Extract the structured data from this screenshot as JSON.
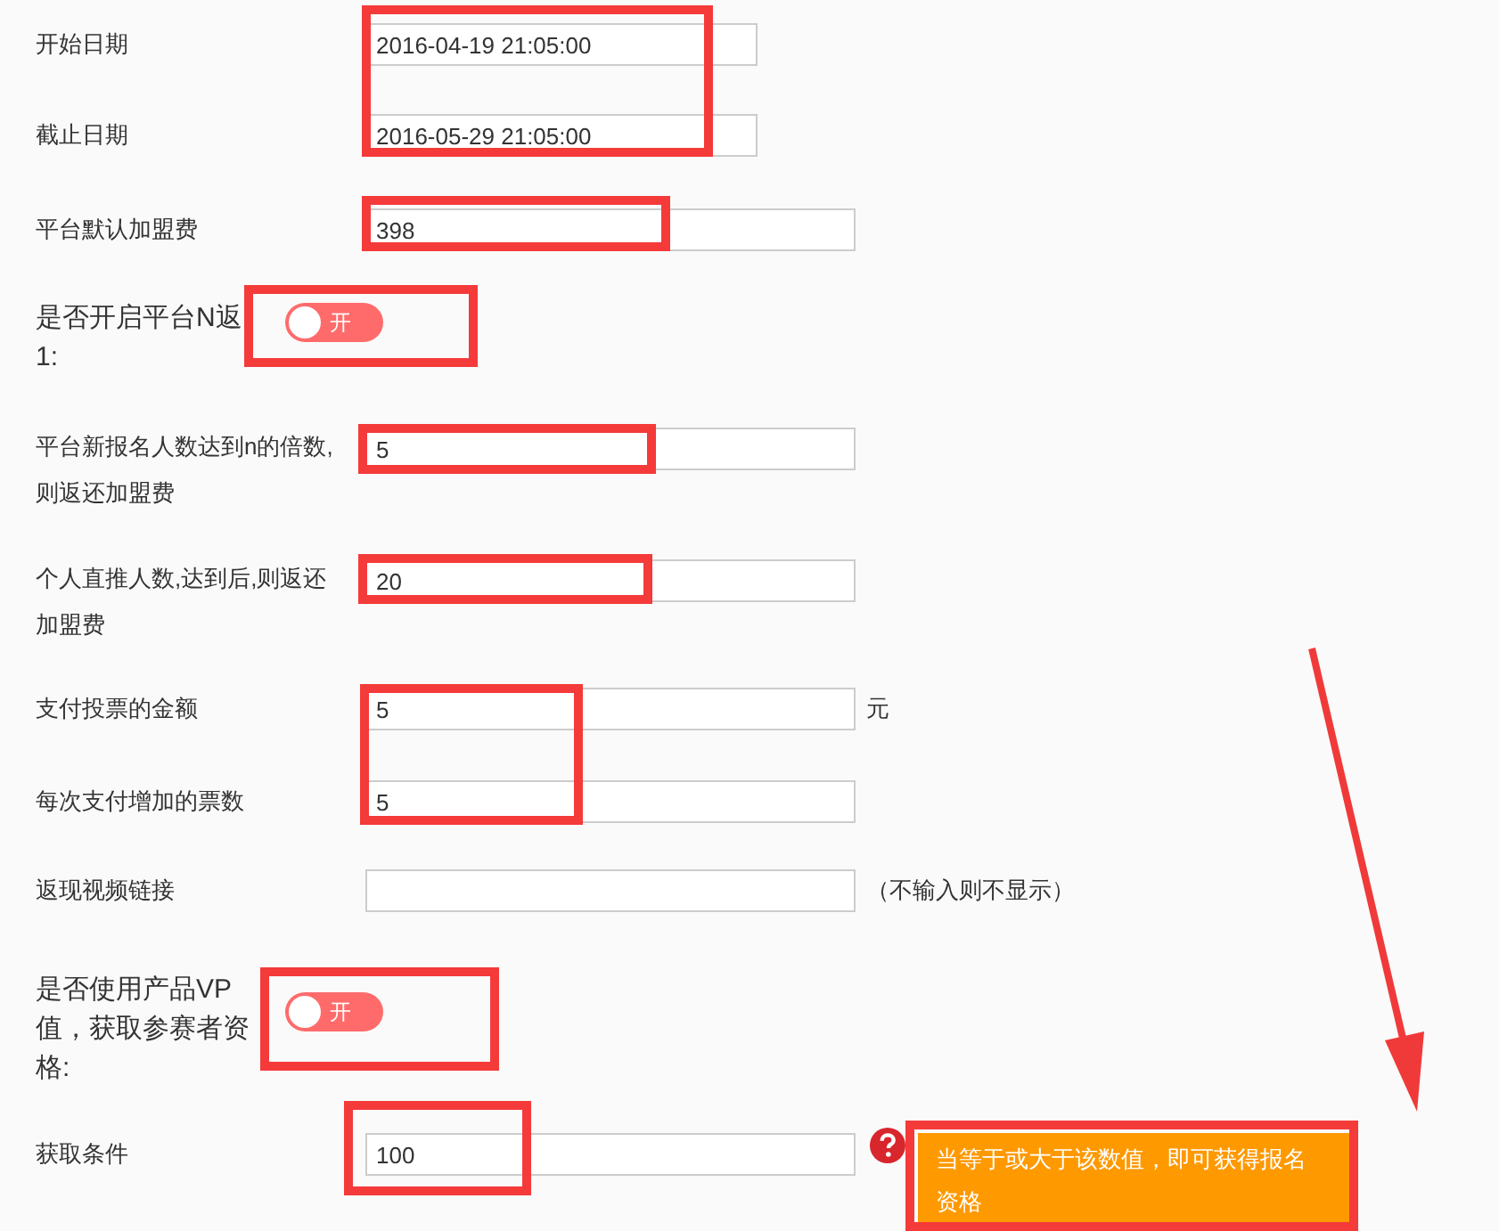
{
  "fields": [
    {
      "kind": "date",
      "label": "开始日期",
      "value": "2016-04-19 21:05:00"
    },
    {
      "kind": "date",
      "label": "截止日期",
      "value": "2016-05-29 21:05:00"
    },
    {
      "kind": "text",
      "label": "平台默认加盟费",
      "value": "398"
    },
    {
      "kind": "toggle",
      "label": "是否开启平台N返1:",
      "on": false,
      "text": "开"
    },
    {
      "kind": "text",
      "label": "平台新报名人数达到n的倍数,则返还加盟费",
      "value": "5"
    },
    {
      "kind": "text",
      "label": "个人直推人数,达到后,则返还加盟费",
      "value": "20"
    },
    {
      "kind": "text",
      "label": "支付投票的金额",
      "value": "5",
      "suffix": "元"
    },
    {
      "kind": "text",
      "label": "每次支付增加的票数",
      "value": "5"
    },
    {
      "kind": "text",
      "label": "返现视频链接",
      "suffix": "（不输入则不显示）"
    },
    {
      "kind": "toggle",
      "label": "是否使用产品VP值，获取参赛者资格:",
      "on": false,
      "text": "开"
    },
    {
      "kind": "text",
      "label": "获取条件",
      "value": "100",
      "help": {
        "tooltip": "当等于或大于该数值，即可获得报名资格"
      }
    }
  ]
}
